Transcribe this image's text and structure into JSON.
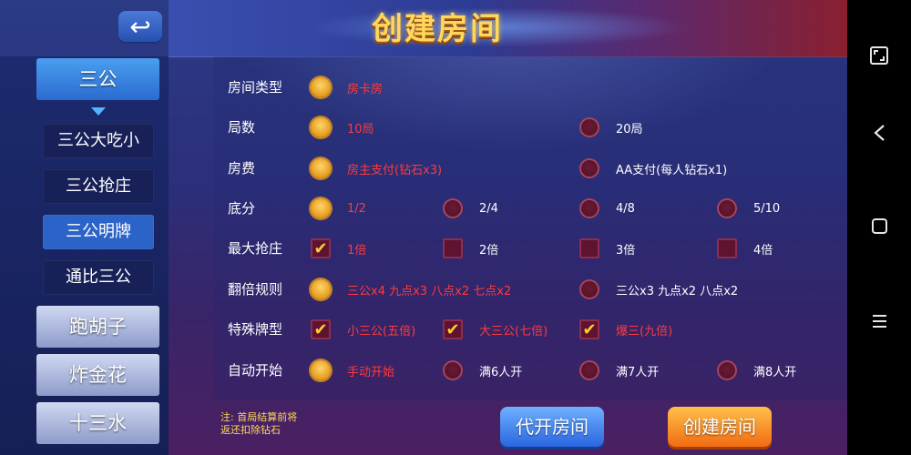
{
  "header": {
    "title": "创建房间",
    "back_icon": "back-arrow-icon"
  },
  "sidebar": {
    "games": [
      {
        "label": "三公",
        "active": true
      },
      {
        "label": "跑胡子",
        "active": false
      },
      {
        "label": "炸金花",
        "active": false
      },
      {
        "label": "十三水",
        "active": false
      }
    ],
    "subgames": [
      {
        "label": "三公大吃小",
        "active": false
      },
      {
        "label": "三公抢庄",
        "active": false
      },
      {
        "label": "三公明牌",
        "active": true
      },
      {
        "label": "通比三公",
        "active": false
      }
    ]
  },
  "settings": [
    {
      "label": "房间类型",
      "control": "radio",
      "options": [
        {
          "text": "房卡房",
          "selected": true
        }
      ]
    },
    {
      "label": "局数",
      "control": "radio",
      "options": [
        {
          "text": "10局",
          "selected": true
        },
        {
          "text": "20局",
          "selected": false
        }
      ]
    },
    {
      "label": "房费",
      "control": "radio",
      "options": [
        {
          "text": "房主支付(钻石x3)",
          "selected": true
        },
        {
          "text": "AA支付(每人钻石x1)",
          "selected": false
        }
      ]
    },
    {
      "label": "底分",
      "control": "radio",
      "options": [
        {
          "text": "1/2",
          "selected": true
        },
        {
          "text": "2/4",
          "selected": false
        },
        {
          "text": "4/8",
          "selected": false
        },
        {
          "text": "5/10",
          "selected": false
        }
      ]
    },
    {
      "label": "最大抢庄",
      "control": "check",
      "options": [
        {
          "text": "1倍",
          "selected": true
        },
        {
          "text": "2倍",
          "selected": false
        },
        {
          "text": "3倍",
          "selected": false
        },
        {
          "text": "4倍",
          "selected": false
        }
      ]
    },
    {
      "label": "翻倍规则",
      "control": "radio",
      "options": [
        {
          "text": "三公x4 九点x3 八点x2 七点x2",
          "selected": true
        },
        {
          "text": "三公x3 九点x2 八点x2",
          "selected": false
        }
      ]
    },
    {
      "label": "特殊牌型",
      "control": "check",
      "options": [
        {
          "text": "小三公(五倍)",
          "selected": true
        },
        {
          "text": "大三公(七倍)",
          "selected": true
        },
        {
          "text": "爆三(九倍)",
          "selected": true
        }
      ]
    },
    {
      "label": "自动开始",
      "control": "radio",
      "options": [
        {
          "text": "手动开始",
          "selected": true
        },
        {
          "text": "满6人开",
          "selected": false
        },
        {
          "text": "满7人开",
          "selected": false
        },
        {
          "text": "满8人开",
          "selected": false
        }
      ]
    }
  ],
  "footer": {
    "note_line1": "注: 首局结算前将",
    "note_line2": "返还扣除钻石",
    "proxy_label": "代开房间",
    "create_label": "创建房间"
  },
  "navbar": {
    "fullscreen_icon": "fullscreen-icon",
    "back_icon": "nav-back-icon",
    "home_icon": "nav-home-icon",
    "menu_icon": "nav-menu-icon"
  },
  "colors": {
    "selected_text": "#ff3b3b",
    "accent_blue": "#2c63c8",
    "accent_orange": "#f26b12"
  }
}
